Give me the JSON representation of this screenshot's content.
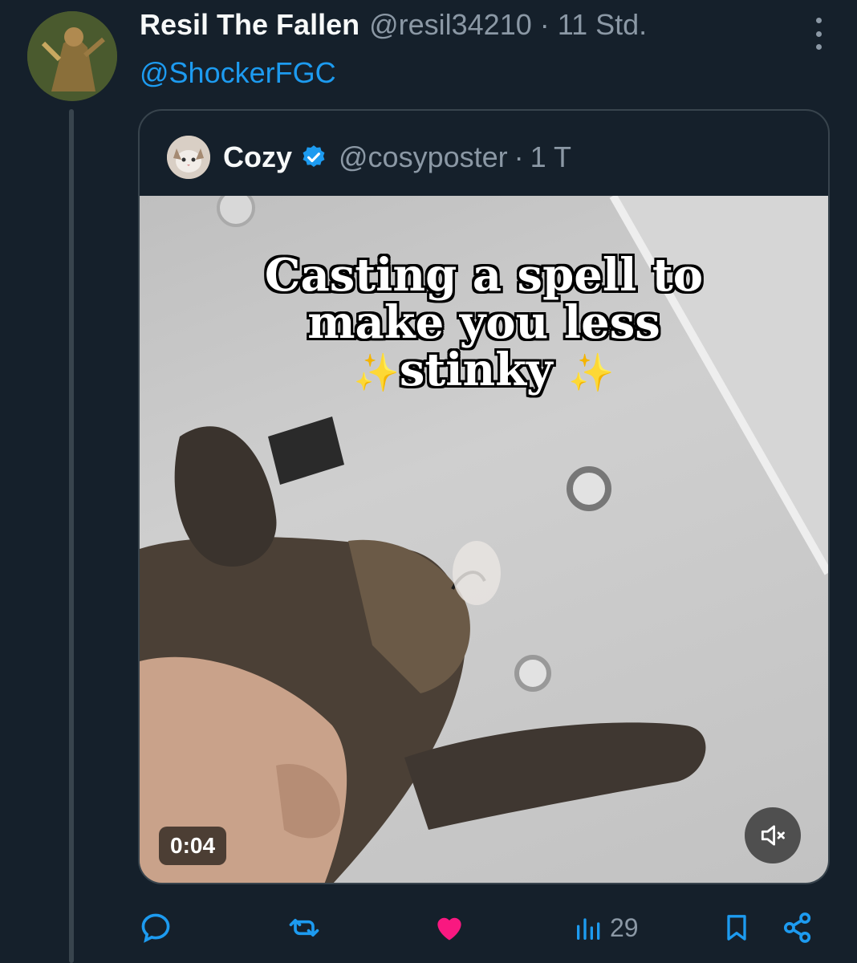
{
  "author": {
    "display_name": "Resil The Fallen",
    "handle": "@resil34210",
    "separator": "·",
    "time": "11 Std."
  },
  "reply_mention": "@ShockerFGC",
  "quoted": {
    "display_name": "Cozy",
    "handle": "@cosyposter",
    "separator": "·",
    "time": "1 T",
    "media": {
      "caption_lines": [
        "Casting a spell to",
        "make you less",
        "stinky"
      ],
      "sparkle": "✨",
      "duration": "0:04"
    }
  },
  "actions": {
    "views_count": "29"
  },
  "colors": {
    "background": "#15202b",
    "accent_blue": "#1d9bf0",
    "like_pink": "#f91880",
    "muted_text": "#8b98a5"
  },
  "icons": [
    "more-icon",
    "verified-badge-icon",
    "mute-icon",
    "reply-icon",
    "retweet-icon",
    "like-icon",
    "views-icon",
    "bookmark-icon",
    "share-icon"
  ]
}
